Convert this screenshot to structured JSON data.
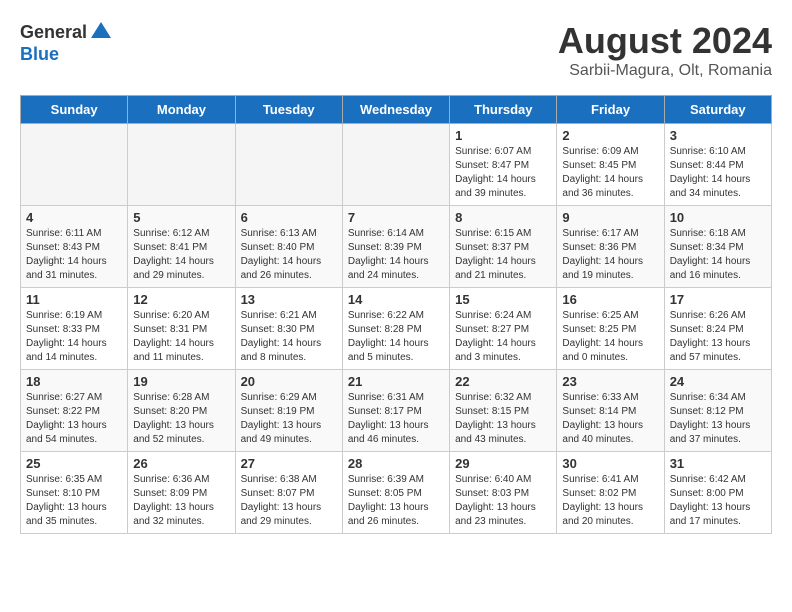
{
  "logo": {
    "general": "General",
    "blue": "Blue"
  },
  "title": {
    "month_year": "August 2024",
    "location": "Sarbii-Magura, Olt, Romania"
  },
  "days_of_week": [
    "Sunday",
    "Monday",
    "Tuesday",
    "Wednesday",
    "Thursday",
    "Friday",
    "Saturday"
  ],
  "weeks": [
    [
      {
        "day": "",
        "text": ""
      },
      {
        "day": "",
        "text": ""
      },
      {
        "day": "",
        "text": ""
      },
      {
        "day": "",
        "text": ""
      },
      {
        "day": "1",
        "text": "Sunrise: 6:07 AM\nSunset: 8:47 PM\nDaylight: 14 hours\nand 39 minutes."
      },
      {
        "day": "2",
        "text": "Sunrise: 6:09 AM\nSunset: 8:45 PM\nDaylight: 14 hours\nand 36 minutes."
      },
      {
        "day": "3",
        "text": "Sunrise: 6:10 AM\nSunset: 8:44 PM\nDaylight: 14 hours\nand 34 minutes."
      }
    ],
    [
      {
        "day": "4",
        "text": "Sunrise: 6:11 AM\nSunset: 8:43 PM\nDaylight: 14 hours\nand 31 minutes."
      },
      {
        "day": "5",
        "text": "Sunrise: 6:12 AM\nSunset: 8:41 PM\nDaylight: 14 hours\nand 29 minutes."
      },
      {
        "day": "6",
        "text": "Sunrise: 6:13 AM\nSunset: 8:40 PM\nDaylight: 14 hours\nand 26 minutes."
      },
      {
        "day": "7",
        "text": "Sunrise: 6:14 AM\nSunset: 8:39 PM\nDaylight: 14 hours\nand 24 minutes."
      },
      {
        "day": "8",
        "text": "Sunrise: 6:15 AM\nSunset: 8:37 PM\nDaylight: 14 hours\nand 21 minutes."
      },
      {
        "day": "9",
        "text": "Sunrise: 6:17 AM\nSunset: 8:36 PM\nDaylight: 14 hours\nand 19 minutes."
      },
      {
        "day": "10",
        "text": "Sunrise: 6:18 AM\nSunset: 8:34 PM\nDaylight: 14 hours\nand 16 minutes."
      }
    ],
    [
      {
        "day": "11",
        "text": "Sunrise: 6:19 AM\nSunset: 8:33 PM\nDaylight: 14 hours\nand 14 minutes."
      },
      {
        "day": "12",
        "text": "Sunrise: 6:20 AM\nSunset: 8:31 PM\nDaylight: 14 hours\nand 11 minutes."
      },
      {
        "day": "13",
        "text": "Sunrise: 6:21 AM\nSunset: 8:30 PM\nDaylight: 14 hours\nand 8 minutes."
      },
      {
        "day": "14",
        "text": "Sunrise: 6:22 AM\nSunset: 8:28 PM\nDaylight: 14 hours\nand 5 minutes."
      },
      {
        "day": "15",
        "text": "Sunrise: 6:24 AM\nSunset: 8:27 PM\nDaylight: 14 hours\nand 3 minutes."
      },
      {
        "day": "16",
        "text": "Sunrise: 6:25 AM\nSunset: 8:25 PM\nDaylight: 14 hours\nand 0 minutes."
      },
      {
        "day": "17",
        "text": "Sunrise: 6:26 AM\nSunset: 8:24 PM\nDaylight: 13 hours\nand 57 minutes."
      }
    ],
    [
      {
        "day": "18",
        "text": "Sunrise: 6:27 AM\nSunset: 8:22 PM\nDaylight: 13 hours\nand 54 minutes."
      },
      {
        "day": "19",
        "text": "Sunrise: 6:28 AM\nSunset: 8:20 PM\nDaylight: 13 hours\nand 52 minutes."
      },
      {
        "day": "20",
        "text": "Sunrise: 6:29 AM\nSunset: 8:19 PM\nDaylight: 13 hours\nand 49 minutes."
      },
      {
        "day": "21",
        "text": "Sunrise: 6:31 AM\nSunset: 8:17 PM\nDaylight: 13 hours\nand 46 minutes."
      },
      {
        "day": "22",
        "text": "Sunrise: 6:32 AM\nSunset: 8:15 PM\nDaylight: 13 hours\nand 43 minutes."
      },
      {
        "day": "23",
        "text": "Sunrise: 6:33 AM\nSunset: 8:14 PM\nDaylight: 13 hours\nand 40 minutes."
      },
      {
        "day": "24",
        "text": "Sunrise: 6:34 AM\nSunset: 8:12 PM\nDaylight: 13 hours\nand 37 minutes."
      }
    ],
    [
      {
        "day": "25",
        "text": "Sunrise: 6:35 AM\nSunset: 8:10 PM\nDaylight: 13 hours\nand 35 minutes."
      },
      {
        "day": "26",
        "text": "Sunrise: 6:36 AM\nSunset: 8:09 PM\nDaylight: 13 hours\nand 32 minutes."
      },
      {
        "day": "27",
        "text": "Sunrise: 6:38 AM\nSunset: 8:07 PM\nDaylight: 13 hours\nand 29 minutes."
      },
      {
        "day": "28",
        "text": "Sunrise: 6:39 AM\nSunset: 8:05 PM\nDaylight: 13 hours\nand 26 minutes."
      },
      {
        "day": "29",
        "text": "Sunrise: 6:40 AM\nSunset: 8:03 PM\nDaylight: 13 hours\nand 23 minutes."
      },
      {
        "day": "30",
        "text": "Sunrise: 6:41 AM\nSunset: 8:02 PM\nDaylight: 13 hours\nand 20 minutes."
      },
      {
        "day": "31",
        "text": "Sunrise: 6:42 AM\nSunset: 8:00 PM\nDaylight: 13 hours\nand 17 minutes."
      }
    ]
  ]
}
